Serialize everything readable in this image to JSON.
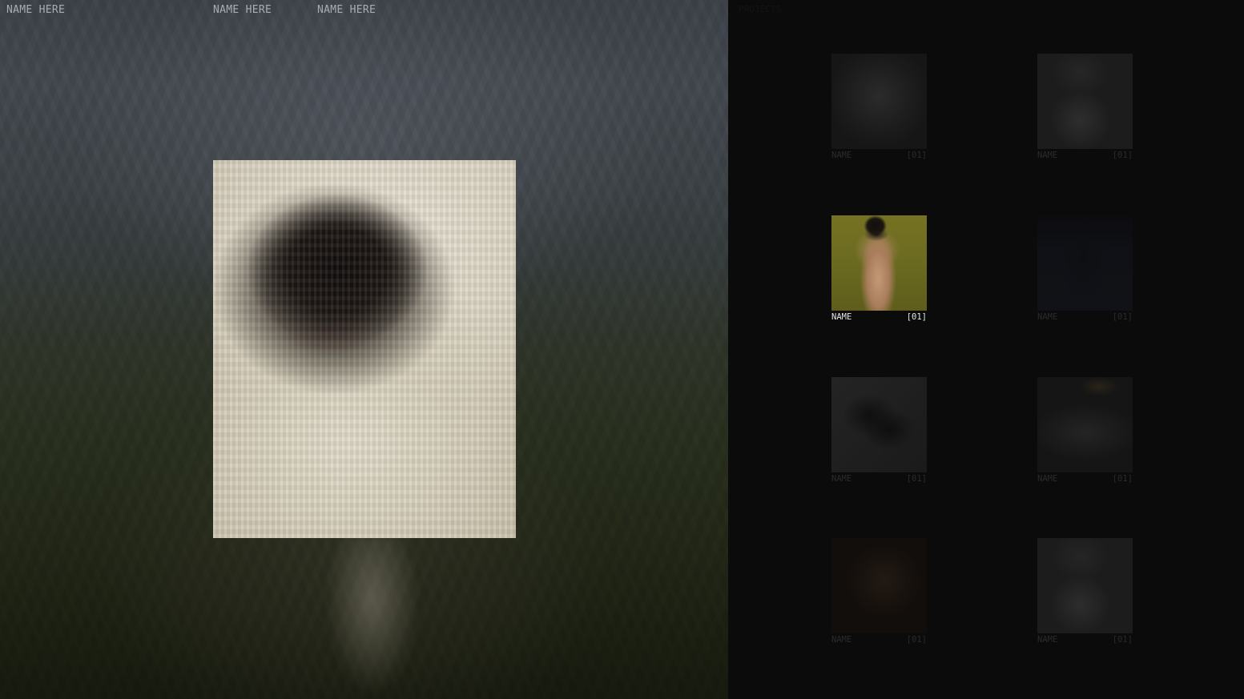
{
  "nav": {
    "links": [
      "NAME HERE",
      "NAME HERE",
      "NAME HERE"
    ]
  },
  "hero": {
    "feature_image": "sweater-portrait"
  },
  "gallery": {
    "label": "PROJECTS",
    "items": [
      {
        "name": "NAME",
        "index": "[01]",
        "image": "faded-portrait"
      },
      {
        "name": "NAME",
        "index": "[01]",
        "image": "woman-in-white"
      },
      {
        "name": "NAME",
        "index": "[01]",
        "image": "back-with-butterflies",
        "active": true
      },
      {
        "name": "NAME",
        "index": "[01]",
        "image": "dark-abstract"
      },
      {
        "name": "NAME",
        "index": "[01]",
        "image": "black-shoes"
      },
      {
        "name": "NAME",
        "index": "[01]",
        "image": "dish"
      },
      {
        "name": "NAME",
        "index": "[01]",
        "image": "portrait-closeup"
      },
      {
        "name": "NAME",
        "index": "[01]",
        "image": "woman-in-white"
      }
    ]
  }
}
